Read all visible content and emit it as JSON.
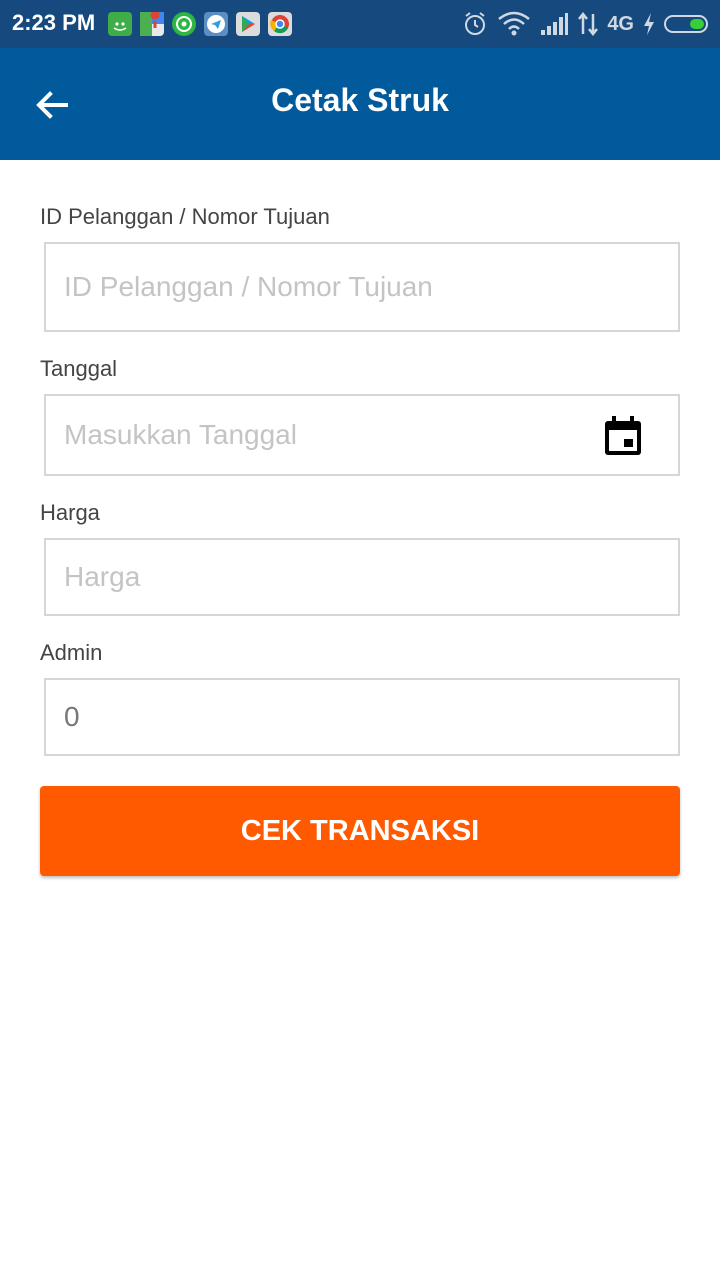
{
  "status_bar": {
    "time": "2:23 PM",
    "network": "4G",
    "notification_icons": [
      "android-icon",
      "maps-icon",
      "whatsapp-icon",
      "telegram-icon",
      "play-store-icon",
      "chrome-icon"
    ],
    "system_icons": [
      "alarm-icon",
      "wifi-icon",
      "signal-icon",
      "data-arrows-icon",
      "charging-icon",
      "battery-icon"
    ]
  },
  "app_bar": {
    "title": "Cetak Struk",
    "back_icon": "arrow-left-icon",
    "color": "#005a9c"
  },
  "form": {
    "id_label": "ID Pelanggan / Nomor Tujuan",
    "id_placeholder": "ID Pelanggan / Nomor Tujuan",
    "date_label": "Tanggal",
    "date_placeholder": "Masukkan Tanggal",
    "date_icon": "calendar-icon",
    "price_label": "Harga",
    "price_placeholder": "Harga",
    "admin_label": "Admin",
    "admin_value": "0"
  },
  "button": {
    "label": "CEK TRANSAKSI",
    "color": "#ff5a00"
  }
}
